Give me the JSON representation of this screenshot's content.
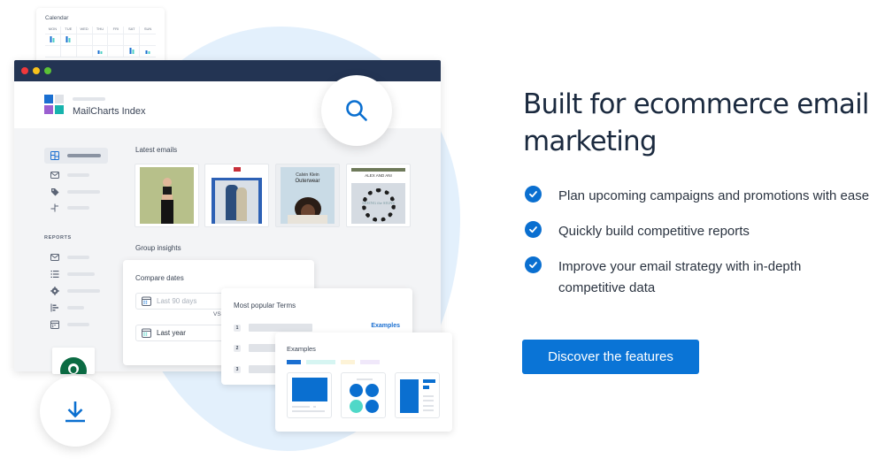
{
  "illustration": {
    "calendar": {
      "title": "Calendar",
      "days": [
        "MON",
        "TUE",
        "WED",
        "THU",
        "FRI",
        "SAT",
        "SUN"
      ]
    },
    "window": {
      "app_name": "MailCharts Index",
      "logo_colors": [
        "#1a6fd1",
        "#dfe2e7",
        "#9b5fd0",
        "#17b3ad"
      ],
      "sidebar": {
        "items": [
          {
            "icon": "dashboard-icon",
            "active": true
          },
          {
            "icon": "mail-icon"
          },
          {
            "icon": "tag-icon"
          },
          {
            "icon": "split-icon"
          }
        ],
        "reports_label": "REPORTS",
        "report_items": [
          {
            "icon": "mail-icon"
          },
          {
            "icon": "list-icon"
          },
          {
            "icon": "gear-icon"
          },
          {
            "icon": "bar-chart-icon"
          },
          {
            "icon": "calendar-icon"
          }
        ]
      },
      "latest_emails_title": "Latest emails",
      "email_thumbnails": [
        {
          "label": "Fitness apparel email"
        },
        {
          "label": "Fashion couple email"
        },
        {
          "label": "Calvin Klein",
          "heading": "Outerwear"
        },
        {
          "label": "ALEX AND ANI",
          "heading": "SEEING the SIGNS"
        }
      ],
      "group_insights_title": "Group insights"
    },
    "compare_dates": {
      "title": "Compare dates",
      "field1_placeholder": "Last 90 days",
      "vs": "VS",
      "field2_value": "Last year"
    },
    "popular_terms": {
      "title": "Most popular Terms",
      "rows": [
        "1",
        "2",
        "3"
      ],
      "examples_link": "Examples"
    },
    "examples_card": {
      "title": "Examples",
      "chip_colors": [
        "#1a6fd1",
        "#d6f5f2",
        "#fdf3d7",
        "#f0e8fa"
      ]
    }
  },
  "content": {
    "headline": "Built for ecommerce email marketing",
    "features": [
      "Plan upcoming campaigns and promotions with ease",
      "Quickly build competitive reports",
      "Improve your email strategy with in-depth competitive data"
    ],
    "cta_label": "Discover the features"
  },
  "colors": {
    "accent": "#0a74d6",
    "titlebar": "#233453",
    "heading": "#1b2a3f"
  }
}
